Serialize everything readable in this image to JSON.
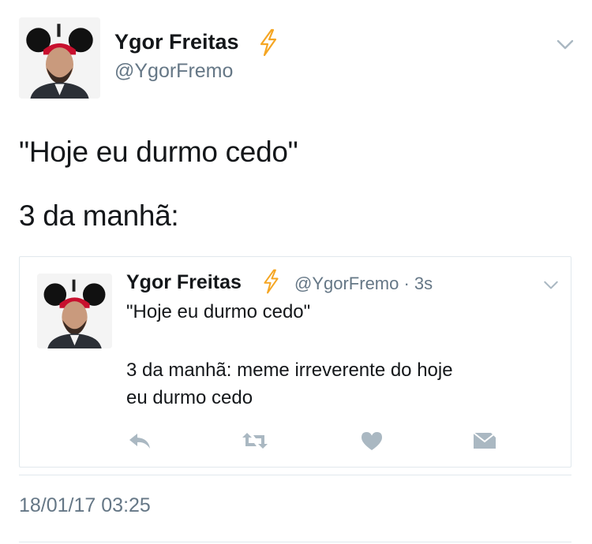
{
  "tweet": {
    "author_name": "Ygor Freitas",
    "author_handle": "@YgorFremo",
    "text_line1": "\"Hoje eu durmo cedo\"",
    "text_line2": "3 da manhã:",
    "timestamp": "18/01/17 03:25"
  },
  "quoted": {
    "author_name": "Ygor Freitas",
    "handle_time": "@YgorFremo · 3s",
    "text_line1": "\"Hoje eu durmo cedo\"",
    "text_line2": "3 da manhã: meme irreverente do hoje",
    "text_line3": "eu durmo cedo"
  },
  "icons": {
    "verified_badge": "lightning-bolt-icon",
    "menu": "chevron-down-icon",
    "actions": [
      "reply-icon",
      "retweet-icon",
      "heart-icon",
      "direct-message-icon"
    ]
  },
  "colors": {
    "text": "#14171a",
    "secondary": "#657786",
    "bolt": "#f5a623",
    "action_icon": "#aab8c2",
    "border": "#e1e8ed"
  }
}
